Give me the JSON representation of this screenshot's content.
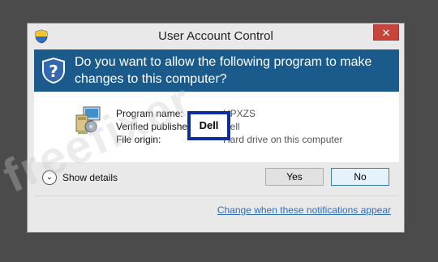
{
  "window": {
    "title": "User Account Control",
    "close_label": "✕"
  },
  "banner": {
    "text": "Do you want to allow the following program to make changes to this computer?"
  },
  "program_info": {
    "name_label": "Program name:",
    "publisher_label": "Verified publisher:",
    "origin_label": "File origin:",
    "name_value": "UPXZS",
    "publisher_value": "Dell",
    "origin_value": "Hard drive on this computer"
  },
  "redaction_label": "Dell",
  "watermark": "freefixer",
  "footer": {
    "show_details": "Show details",
    "yes": "Yes",
    "no": "No",
    "change_link": "Change when these notifications appear"
  },
  "colors": {
    "banner": "#1b5b8c",
    "close": "#c7453b",
    "link": "#2c6fbb",
    "highlight_box": "#0b2e9c"
  }
}
